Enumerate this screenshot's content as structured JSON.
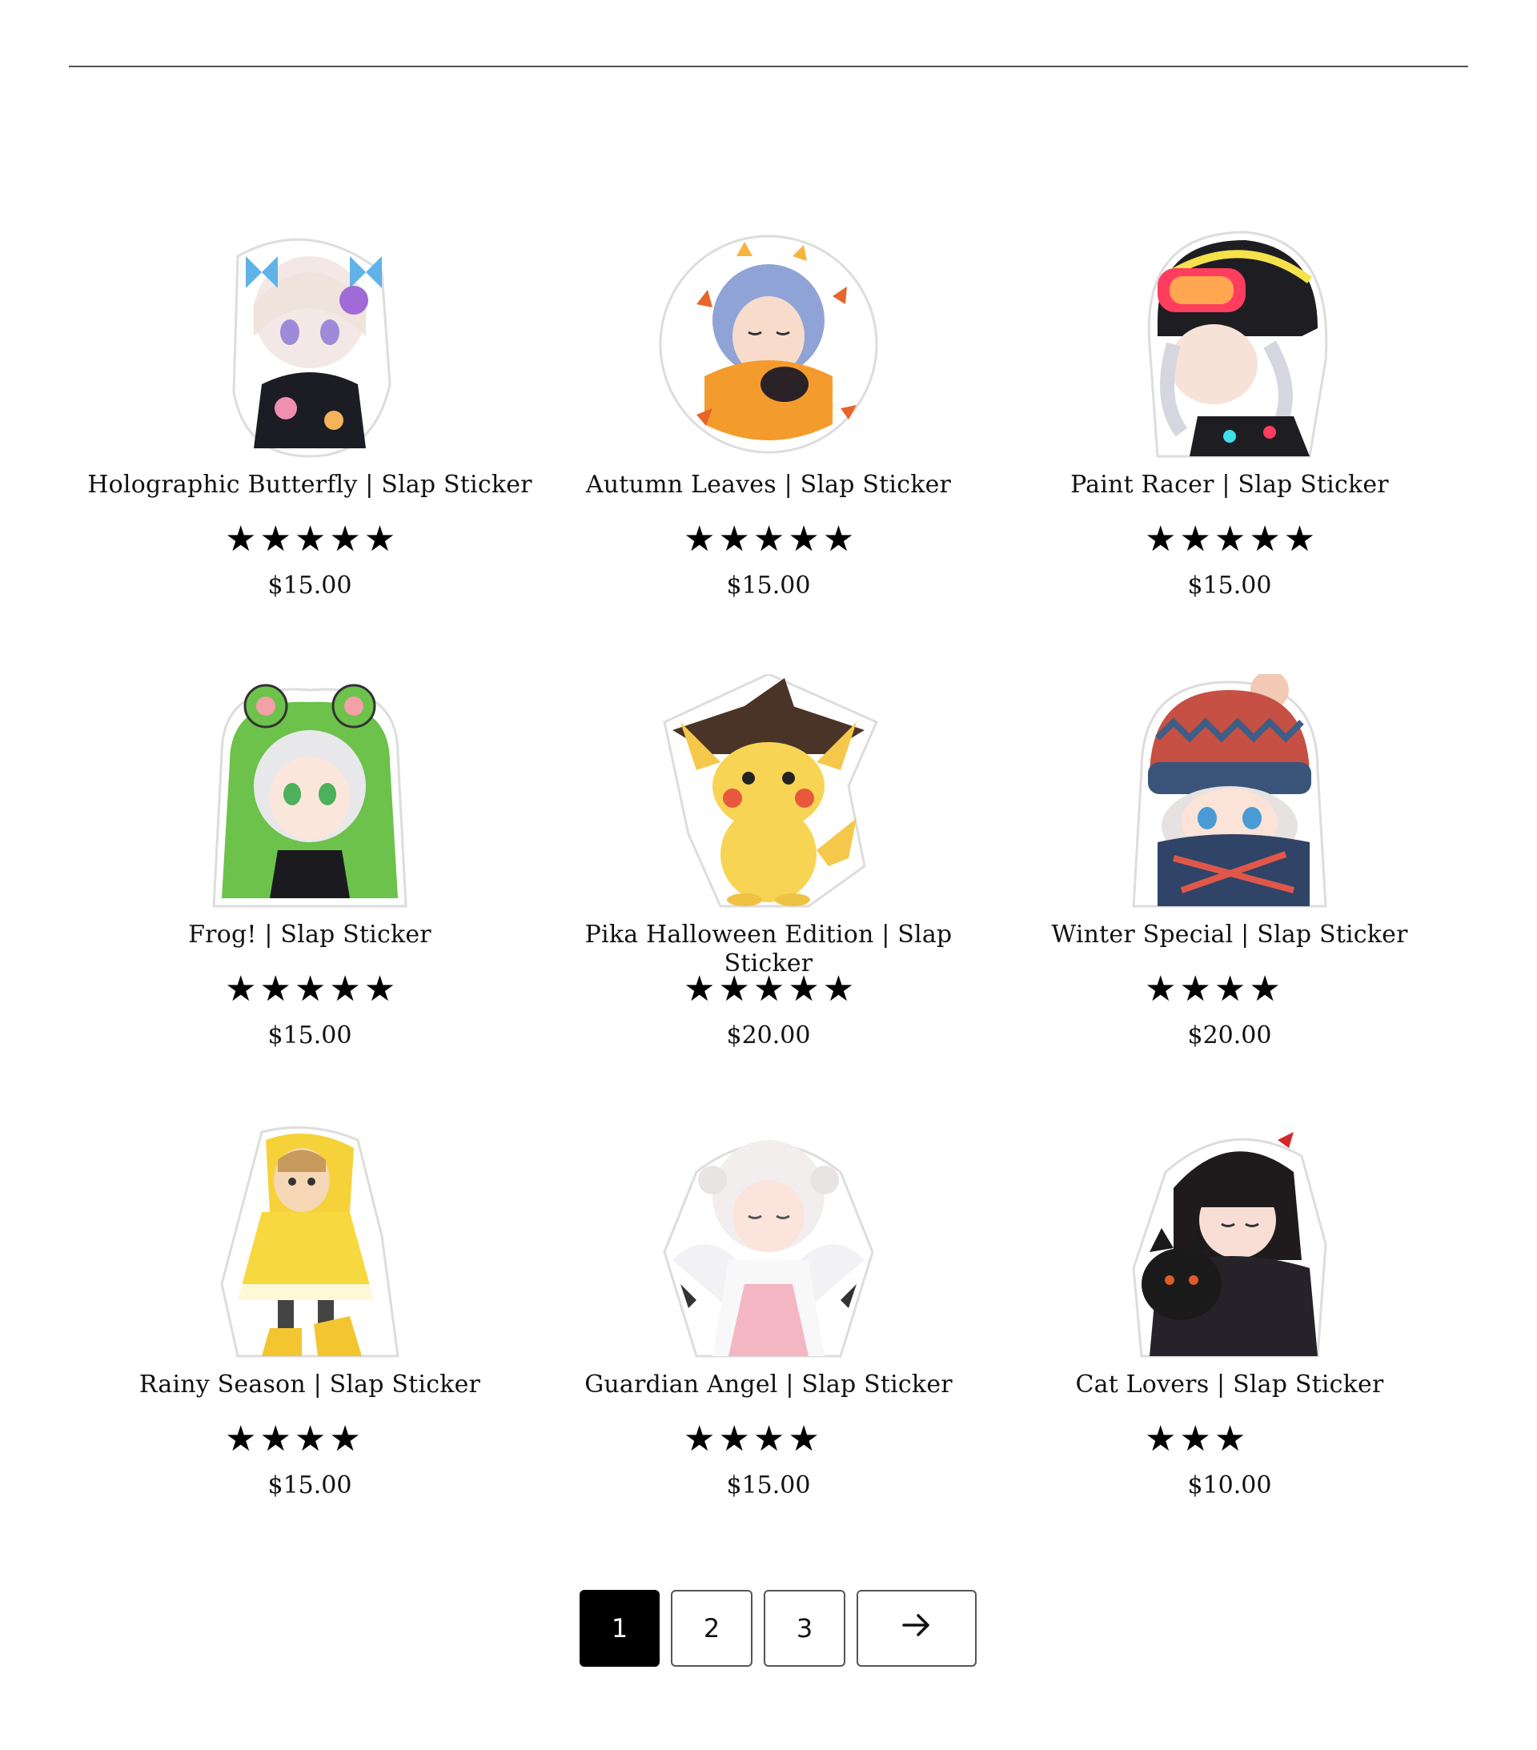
{
  "products": [
    {
      "title": "Holographic Butterfly | Slap Sticker",
      "rating": 5,
      "stars": "★★★★★",
      "price": "$15.00",
      "image": "anime-girl-butterfly-sticker"
    },
    {
      "title": "Autumn Leaves | Slap Sticker",
      "rating": 5,
      "stars": "★★★★★",
      "price": "$15.00",
      "image": "anime-girl-autumn-leaves-sticker"
    },
    {
      "title": "Paint Racer | Slap Sticker",
      "rating": 5,
      "stars": "★★★★★",
      "price": "$15.00",
      "image": "anime-girl-racer-helmet-sticker"
    },
    {
      "title": "Frog! | Slap Sticker",
      "rating": 5,
      "stars": "★★★★★",
      "price": "$15.00",
      "image": "anime-girl-frog-hood-sticker"
    },
    {
      "title": "Pika Halloween Edition | Slap Sticker",
      "rating": 5,
      "stars": "★★★★★",
      "price": "$20.00",
      "image": "pikachu-witch-hat-sticker"
    },
    {
      "title": "Winter Special | Slap Sticker",
      "rating": 4,
      "stars": "★★★★",
      "price": "$20.00",
      "image": "anime-girl-winter-beanie-sticker"
    },
    {
      "title": "Rainy Season | Slap Sticker",
      "rating": 4,
      "stars": "★★★★",
      "price": "$15.00",
      "image": "anime-girl-yellow-raincoat-sticker"
    },
    {
      "title": "Guardian Angel | Slap Sticker",
      "rating": 4,
      "stars": "★★★★",
      "price": "$15.00",
      "image": "anime-angel-girl-sticker"
    },
    {
      "title": "Cat Lovers | Slap Sticker",
      "rating": 3,
      "stars": "★★★",
      "price": "$10.00",
      "image": "anime-girl-black-cat-sticker"
    }
  ],
  "pagination": {
    "pages": [
      "1",
      "2",
      "3"
    ],
    "current": 1,
    "next_icon": "arrow-right-icon"
  },
  "colors": {
    "pager_active_bg": "#000000",
    "pager_active_text": "#ffffff",
    "star": "#000000"
  }
}
